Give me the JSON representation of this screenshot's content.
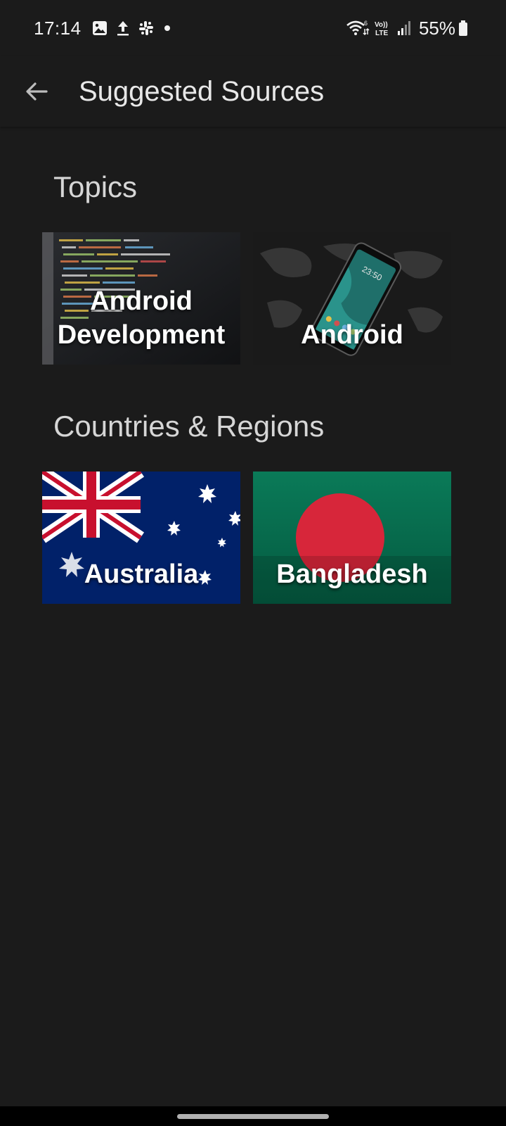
{
  "status_bar": {
    "time": "17:14",
    "battery": "55%",
    "left_icons": [
      "gallery-icon",
      "upload-icon",
      "slack-icon",
      "notification-dot"
    ],
    "right_icons": [
      "wifi-6-icon",
      "volte-icon",
      "signal-icon",
      "battery-icon"
    ]
  },
  "app_bar": {
    "back_icon": "arrow-left-icon",
    "title": "Suggested Sources"
  },
  "sections": [
    {
      "title": "Topics",
      "tiles": [
        {
          "label": "Android\nDevelopment",
          "image": "code-editor-screenshot"
        },
        {
          "label": "Android",
          "image": "smartphone-on-world-map"
        }
      ]
    },
    {
      "title": "Countries & Regions",
      "tiles": [
        {
          "label": "Australia",
          "image": "australia-flag"
        },
        {
          "label": "Bangladesh",
          "image": "bangladesh-flag"
        }
      ]
    }
  ],
  "colors": {
    "background": "#1b1b1b",
    "text_primary": "#e8e8e8",
    "bangladesh_green": "#006a4e",
    "bangladesh_red": "#d7263a",
    "australia_blue": "#012169",
    "union_red": "#c8102e"
  }
}
